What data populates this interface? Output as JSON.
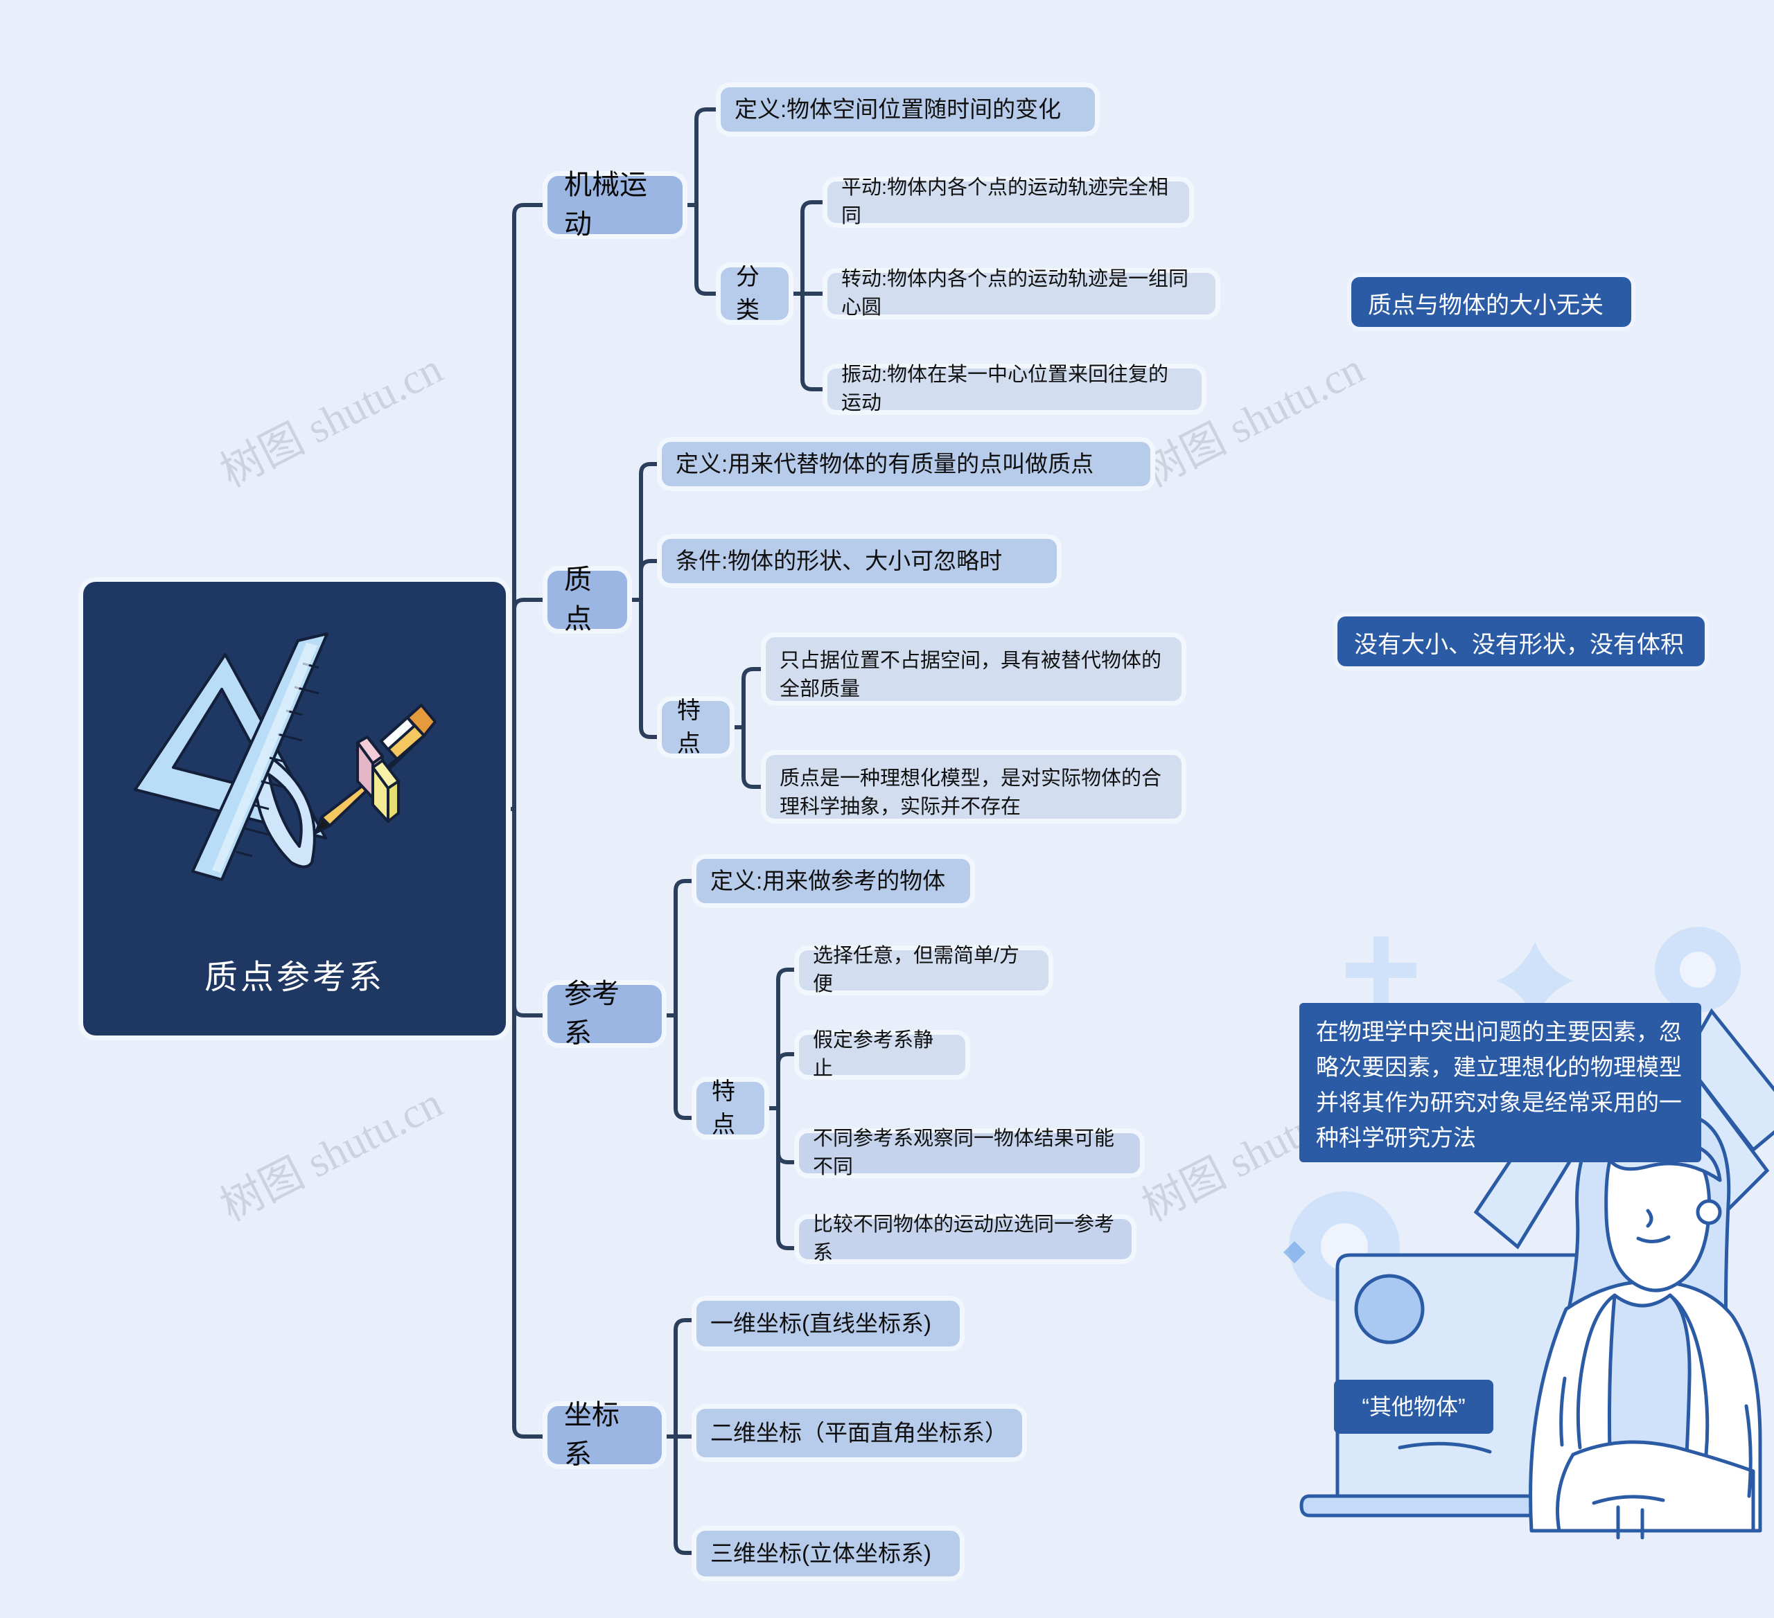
{
  "root": {
    "title": "质点参考系",
    "bg_color": "#1e3763",
    "art": "ruler-triangle-pencil-eraser-illustration"
  },
  "colors": {
    "page_bg": "#e8effb",
    "level1_node": "#9bb6e2",
    "level2_node": "#b7cbeb",
    "leaf_node": "#d2ddef",
    "connector": "#2b3f5c",
    "callout_bg": "#2a5ba4",
    "callout_text": "#ffffff"
  },
  "watermark": {
    "text": "树图 shutu.cn"
  },
  "branches": [
    {
      "label": "机械运动",
      "children": [
        {
          "label": "定义:物体空间位置随时间的变化",
          "children": []
        },
        {
          "label": "分类",
          "children": [
            {
              "label": "平动:物体内各个点的运动轨迹完全相同"
            },
            {
              "label": "转动:物体内各个点的运动轨迹是一组同心圆"
            },
            {
              "label": "振动:物体在某一中心位置来回往复的运动"
            }
          ]
        }
      ]
    },
    {
      "label": "质点",
      "children": [
        {
          "label": "定义:用来代替物体的有质量的点叫做质点",
          "children": []
        },
        {
          "label": "条件:物体的形状、大小可忽略时",
          "children": []
        },
        {
          "label": "特点",
          "children": [
            {
              "label": "只占据位置不占据空间，具有被替代物体的全部质量"
            },
            {
              "label": "质点是一种理想化模型，是对实际物体的合理科学抽象，实际并不存在"
            }
          ]
        }
      ]
    },
    {
      "label": "参考系",
      "children": [
        {
          "label": "定义:用来做参考的物体",
          "children": []
        },
        {
          "label": "特点",
          "children": [
            {
              "label": "选择任意，但需简单/方便"
            },
            {
              "label": "假定参考系静止"
            },
            {
              "label": "不同参考系观察同一物体结果可能不同"
            },
            {
              "label": "比较不同物体的运动应选同一参考系"
            }
          ]
        }
      ]
    },
    {
      "label": "坐标系",
      "children": [
        {
          "label": "一维坐标(直线坐标系)",
          "children": []
        },
        {
          "label": "二维坐标（平面直角坐标系）",
          "children": []
        },
        {
          "label": "三维坐标(立体坐标系)",
          "children": []
        }
      ]
    }
  ],
  "callouts": [
    {
      "text": "质点与物体的大小无关"
    },
    {
      "text": "没有大小、没有形状，没有体积"
    },
    {
      "text": "在物理学中突出问题的主要因素，忽略次要因素，建立理想化的物理模型并将其作为研究对象是经常采用的一种科学研究方法"
    },
    {
      "text": "“其他物体”"
    }
  ]
}
